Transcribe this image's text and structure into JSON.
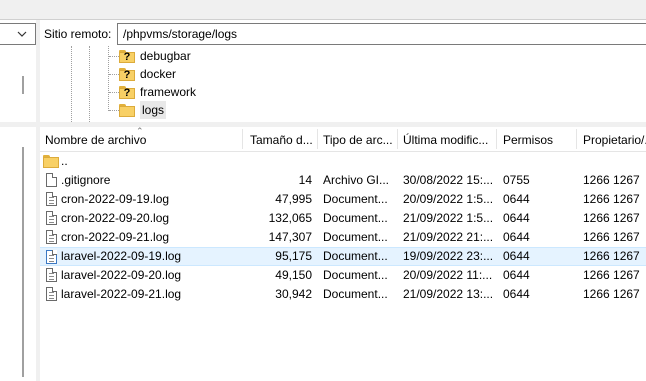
{
  "remote": {
    "path_label": "Sitio remoto:",
    "path_value": "/phpvms/storage/logs"
  },
  "tree": {
    "items": [
      {
        "label": "debugbar",
        "icon": "folder-unknown-icon"
      },
      {
        "label": "docker",
        "icon": "folder-unknown-icon"
      },
      {
        "label": "framework",
        "icon": "folder-unknown-icon"
      },
      {
        "label": "logs",
        "icon": "folder-icon"
      }
    ]
  },
  "list": {
    "columns": [
      "Nombre de archivo",
      "Tamaño d...",
      "Tipo de arc...",
      "Última modific...",
      "Permisos",
      "Propietario/..."
    ],
    "parent_label": "..",
    "rows": [
      {
        "name": ".gitignore",
        "size": "14",
        "type": "Archivo GI...",
        "modified": "30/08/2022 15:...",
        "perms": "0755",
        "owner": "1266 1267"
      },
      {
        "name": "cron-2022-09-19.log",
        "size": "47,995",
        "type": "Document...",
        "modified": "20/09/2022 1:5...",
        "perms": "0644",
        "owner": "1266 1267"
      },
      {
        "name": "cron-2022-09-20.log",
        "size": "132,065",
        "type": "Document...",
        "modified": "21/09/2022 1:5...",
        "perms": "0644",
        "owner": "1266 1267"
      },
      {
        "name": "cron-2022-09-21.log",
        "size": "147,307",
        "type": "Document...",
        "modified": "21/09/2022 21:...",
        "perms": "0644",
        "owner": "1266 1267"
      },
      {
        "name": "laravel-2022-09-19.log",
        "size": "95,175",
        "type": "Document...",
        "modified": "19/09/2022 23:...",
        "perms": "0644",
        "owner": "1266 1267"
      },
      {
        "name": "laravel-2022-09-20.log",
        "size": "49,150",
        "type": "Document...",
        "modified": "20/09/2022 11:...",
        "perms": "0644",
        "owner": "1266 1267"
      },
      {
        "name": "laravel-2022-09-21.log",
        "size": "30,942",
        "type": "Document...",
        "modified": "21/09/2022 13:...",
        "perms": "0644",
        "owner": "1266 1267"
      }
    ]
  },
  "colors": {
    "selection": "#e5f3ff",
    "folder": "#f8d065",
    "splitter": "#f0f0f0"
  }
}
